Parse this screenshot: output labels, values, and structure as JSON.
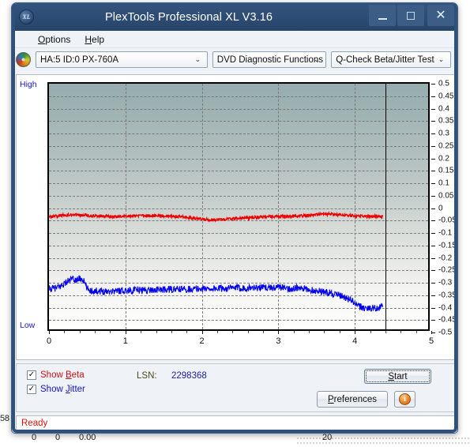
{
  "window": {
    "title": "PlexTools Professional XL V3.16",
    "app_icon": "XL",
    "minimize_label": "minimize",
    "maximize_label": "maximize",
    "close_label": "close"
  },
  "menubar": {
    "items": [
      {
        "label": "Options",
        "accel": "O"
      },
      {
        "label": "Help",
        "accel": "H"
      }
    ]
  },
  "toolbar": {
    "drive_icon": "optical-disc-icon",
    "drive": "HA:5 ID:0  PX-760A",
    "function": "DVD Diagnostic Functions",
    "test": "Q-Check Beta/Jitter Test",
    "caret": "⌄"
  },
  "chart_labels": {
    "high": "High",
    "low": "Low"
  },
  "controls": {
    "show_beta": {
      "label": "Show Beta",
      "checked": true,
      "check_glyph": "✓",
      "color": "#cc1111"
    },
    "show_jitter": {
      "label": "Show Jitter",
      "checked": true,
      "check_glyph": "✓",
      "color": "#1414c4"
    },
    "lsn_label": "LSN:",
    "lsn_value": "2298368",
    "start": "Start",
    "preferences": "Preferences",
    "info": "i"
  },
  "status": {
    "text": "Ready",
    "color": "#dd1111"
  },
  "background": {
    "left_fragment": "58",
    "row_values": [
      "0",
      "0",
      "0.00",
      "20"
    ]
  },
  "chart_data": {
    "type": "line",
    "title": "Q-Check Beta/Jitter Test",
    "xlabel": "",
    "ylabel": "",
    "xlim": [
      0,
      5
    ],
    "ylim": [
      -0.5,
      0.5
    ],
    "xticks": [
      0,
      1,
      2,
      3,
      4,
      5
    ],
    "yticks": [
      0.5,
      0.45,
      0.4,
      0.35,
      0.3,
      0.25,
      0.2,
      0.15,
      0.1,
      0.05,
      0,
      -0.05,
      -0.1,
      -0.15,
      -0.2,
      -0.25,
      -0.3,
      -0.35,
      -0.4,
      -0.45,
      -0.5
    ],
    "ytick_labels": [
      "0.5",
      "0.45",
      "0.4",
      "0.35",
      "0.3",
      "0.25",
      "0.2",
      "0.15",
      "0.1",
      "0.05",
      "0",
      "-0.05",
      "-0.1",
      "-0.15",
      "-0.2",
      "-0.25",
      "-0.3",
      "-0.35",
      "-0.4",
      "-0.45",
      "-0.5"
    ],
    "grid": true,
    "axis_note_high": "High",
    "axis_note_low": "Low",
    "data_end_marker_x": 4.4,
    "legend": [
      "Show Beta",
      "Show Jitter"
    ],
    "series": [
      {
        "name": "Beta",
        "color": "#ee0000",
        "x": [
          0.0,
          0.05,
          0.1,
          0.15,
          0.2,
          0.25,
          0.3,
          0.35,
          0.4,
          0.45,
          0.5,
          0.55,
          0.6,
          0.65,
          0.7,
          0.75,
          0.8,
          0.85,
          0.9,
          0.95,
          1.0,
          1.05,
          1.1,
          1.15,
          1.2,
          1.25,
          1.3,
          1.35,
          1.4,
          1.45,
          1.5,
          1.55,
          1.6,
          1.65,
          1.7,
          1.75,
          1.8,
          1.85,
          1.9,
          1.95,
          2.0,
          2.05,
          2.1,
          2.15,
          2.2,
          2.25,
          2.3,
          2.35,
          2.4,
          2.45,
          2.5,
          2.55,
          2.6,
          2.65,
          2.7,
          2.75,
          2.8,
          2.85,
          2.9,
          2.95,
          3.0,
          3.05,
          3.1,
          3.15,
          3.2,
          3.25,
          3.3,
          3.35,
          3.4,
          3.45,
          3.5,
          3.55,
          3.6,
          3.65,
          3.7,
          3.75,
          3.8,
          3.85,
          3.9,
          3.95,
          4.0,
          4.05,
          4.1,
          4.15,
          4.2,
          4.25,
          4.3,
          4.35,
          4.4
        ],
        "y": [
          -0.04,
          -0.039,
          -0.036,
          -0.034,
          -0.033,
          -0.032,
          -0.031,
          -0.032,
          -0.033,
          -0.033,
          -0.034,
          -0.035,
          -0.035,
          -0.036,
          -0.037,
          -0.037,
          -0.038,
          -0.038,
          -0.038,
          -0.037,
          -0.037,
          -0.036,
          -0.036,
          -0.037,
          -0.037,
          -0.036,
          -0.036,
          -0.035,
          -0.035,
          -0.036,
          -0.036,
          -0.037,
          -0.037,
          -0.038,
          -0.039,
          -0.04,
          -0.041,
          -0.043,
          -0.045,
          -0.047,
          -0.049,
          -0.05,
          -0.051,
          -0.051,
          -0.051,
          -0.05,
          -0.05,
          -0.049,
          -0.048,
          -0.047,
          -0.046,
          -0.045,
          -0.044,
          -0.043,
          -0.042,
          -0.041,
          -0.04,
          -0.039,
          -0.039,
          -0.038,
          -0.038,
          -0.038,
          -0.038,
          -0.037,
          -0.037,
          -0.036,
          -0.036,
          -0.035,
          -0.034,
          -0.033,
          -0.031,
          -0.03,
          -0.029,
          -0.029,
          -0.029,
          -0.03,
          -0.031,
          -0.032,
          -0.033,
          -0.034,
          -0.035,
          -0.036,
          -0.036,
          -0.037,
          -0.037,
          -0.038,
          -0.038,
          -0.038,
          -0.038
        ],
        "noise": 0.006
      },
      {
        "name": "Jitter",
        "color": "#0000ee",
        "x": [
          0.0,
          0.05,
          0.1,
          0.15,
          0.2,
          0.25,
          0.3,
          0.35,
          0.4,
          0.45,
          0.5,
          0.55,
          0.6,
          0.65,
          0.7,
          0.75,
          0.8,
          0.85,
          0.9,
          0.95,
          1.0,
          1.05,
          1.1,
          1.15,
          1.2,
          1.25,
          1.3,
          1.35,
          1.4,
          1.45,
          1.5,
          1.55,
          1.6,
          1.65,
          1.7,
          1.75,
          1.8,
          1.85,
          1.9,
          1.95,
          2.0,
          2.05,
          2.1,
          2.15,
          2.2,
          2.25,
          2.3,
          2.35,
          2.4,
          2.45,
          2.5,
          2.55,
          2.6,
          2.65,
          2.7,
          2.75,
          2.8,
          2.85,
          2.9,
          2.95,
          3.0,
          3.05,
          3.1,
          3.15,
          3.2,
          3.25,
          3.3,
          3.35,
          3.4,
          3.45,
          3.5,
          3.55,
          3.6,
          3.65,
          3.7,
          3.75,
          3.8,
          3.85,
          3.9,
          3.95,
          4.0,
          4.05,
          4.1,
          4.15,
          4.2,
          4.25,
          4.3,
          4.35,
          4.4
        ],
        "y": [
          -0.332,
          -0.33,
          -0.328,
          -0.322,
          -0.31,
          -0.3,
          -0.292,
          -0.296,
          -0.29,
          -0.294,
          -0.33,
          -0.338,
          -0.34,
          -0.34,
          -0.341,
          -0.341,
          -0.34,
          -0.34,
          -0.339,
          -0.339,
          -0.338,
          -0.338,
          -0.337,
          -0.337,
          -0.337,
          -0.336,
          -0.336,
          -0.336,
          -0.335,
          -0.335,
          -0.335,
          -0.334,
          -0.334,
          -0.334,
          -0.333,
          -0.333,
          -0.333,
          -0.332,
          -0.332,
          -0.332,
          -0.331,
          -0.331,
          -0.331,
          -0.33,
          -0.33,
          -0.33,
          -0.329,
          -0.329,
          -0.329,
          -0.328,
          -0.328,
          -0.328,
          -0.328,
          -0.327,
          -0.327,
          -0.327,
          -0.327,
          -0.326,
          -0.326,
          -0.326,
          -0.326,
          -0.325,
          -0.326,
          -0.332,
          -0.33,
          -0.328,
          -0.33,
          -0.332,
          -0.334,
          -0.336,
          -0.338,
          -0.34,
          -0.342,
          -0.345,
          -0.348,
          -0.352,
          -0.356,
          -0.36,
          -0.366,
          -0.373,
          -0.382,
          -0.395,
          -0.404,
          -0.408,
          -0.41,
          -0.41,
          -0.409,
          -0.407,
          -0.405
        ],
        "noise": 0.014
      }
    ]
  }
}
